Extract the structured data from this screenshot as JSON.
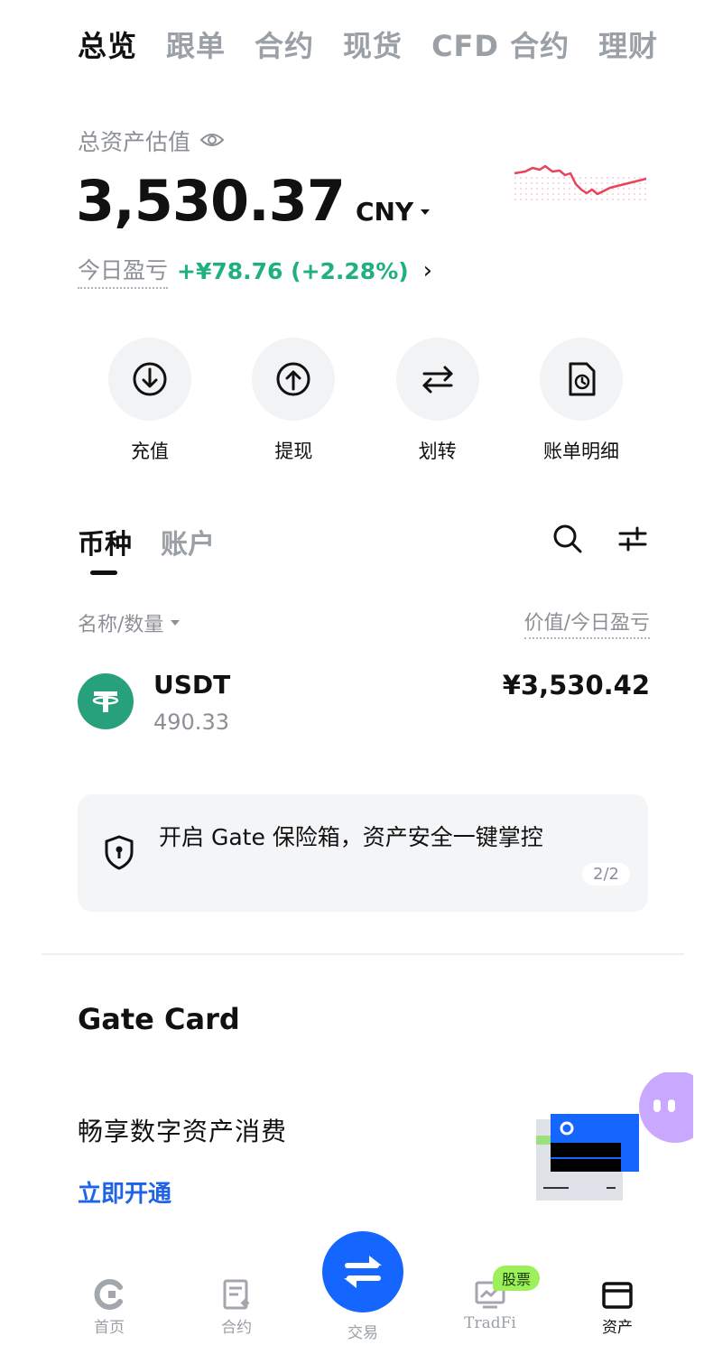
{
  "top_tabs": [
    {
      "label": "总览"
    },
    {
      "label": "跟单"
    },
    {
      "label": "合约"
    },
    {
      "label": "现货"
    },
    {
      "label": "CFD 合约"
    },
    {
      "label": "理财"
    }
  ],
  "overview": {
    "label": "总资产估值",
    "amount": "3,530.37",
    "currency": "CNY",
    "pnl_label": "今日盈亏",
    "pnl_value": "+¥78.76 (+2.28%)"
  },
  "actions": [
    {
      "label": "充值",
      "icon": "deposit-icon"
    },
    {
      "label": "提现",
      "icon": "withdraw-icon"
    },
    {
      "label": "划转",
      "icon": "transfer-icon"
    },
    {
      "label": "账单明细",
      "icon": "bill-icon"
    }
  ],
  "sub_tabs": [
    {
      "label": "币种"
    },
    {
      "label": "账户"
    }
  ],
  "list_header": {
    "left": "名称/数量",
    "right": "价值/今日盈亏"
  },
  "assets": [
    {
      "symbol": "USDT",
      "quantity": "490.33",
      "value": "¥3,530.42"
    }
  ],
  "safe_banner": {
    "text": "开启 Gate 保险箱，资产安全一键掌控",
    "pager": "2/2"
  },
  "gate_card": {
    "title": "Gate Card",
    "subtitle": "畅享数字资产消费",
    "cta": "立即开通"
  },
  "bottom_nav": [
    {
      "label": "首页",
      "icon": "home-icon"
    },
    {
      "label": "合约",
      "icon": "contract-icon"
    },
    {
      "label": "交易",
      "icon": "trade-icon"
    },
    {
      "label": "TradFi",
      "icon": "tradfi-icon",
      "badge": "股票"
    },
    {
      "label": "资产",
      "icon": "wallet-icon"
    }
  ],
  "colors": {
    "accent": "#1565ff",
    "profit": "#1fb17d",
    "tether": "#26a17b",
    "link": "#1e63e8"
  }
}
